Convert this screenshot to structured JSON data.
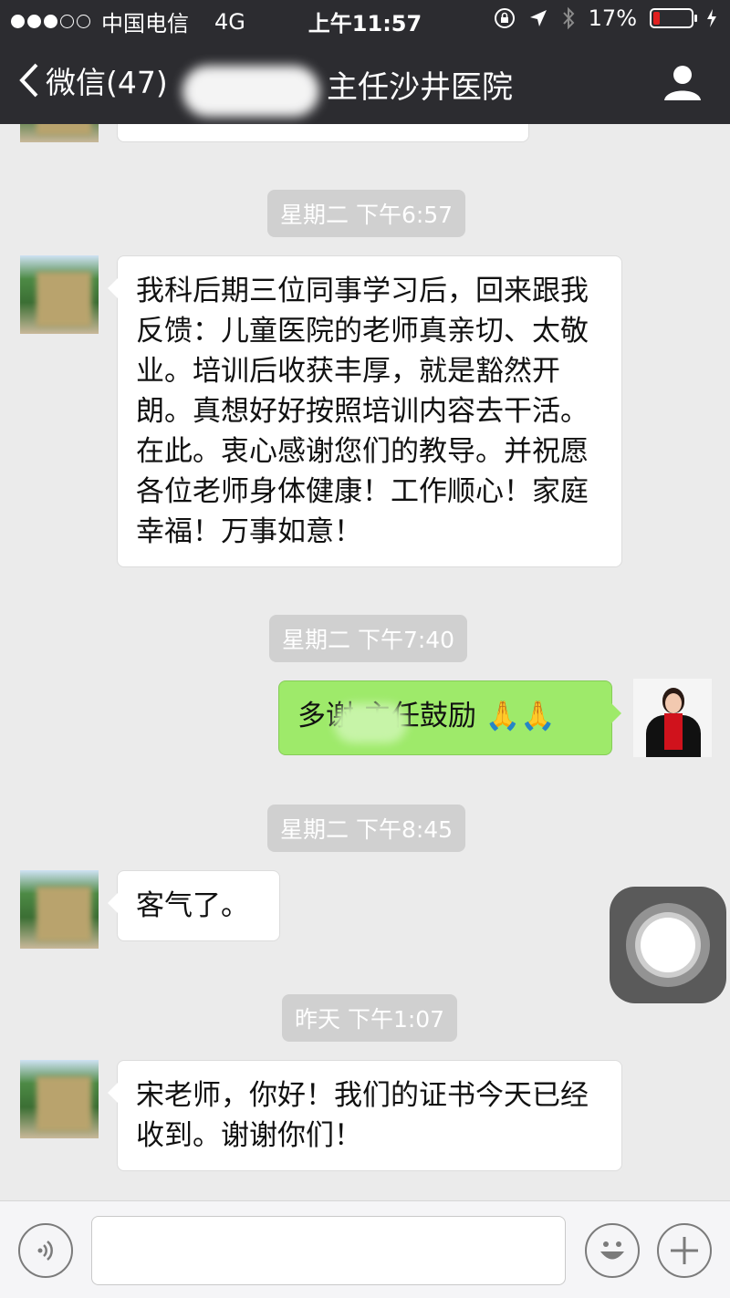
{
  "status_bar": {
    "carrier": "中国电信",
    "network": "4G",
    "time": "上午11:57",
    "battery_text": "17%",
    "battery_level": 0.17,
    "signal_bars_filled": 3,
    "signal_bars_total": 5
  },
  "nav": {
    "back_label": "微信(47)",
    "title": "主任沙井医院"
  },
  "messages": [
    {
      "type": "time",
      "text": "星期二 下午6:57"
    },
    {
      "type": "incoming",
      "text": "我科后期三位同事学习后，回来跟我反馈：儿童医院的老师真亲切、太敬业。培训后收获丰厚，就是豁然开朗。真想好好按照培训内容去干活。在此。衷心感谢您们的教导。并祝愿各位老师身体健康！工作顺心！家庭幸福！万事如意！"
    },
    {
      "type": "time",
      "text": "星期二 下午7:40"
    },
    {
      "type": "outgoing",
      "text_prefix": "多谢",
      "text_suffix": "主任鼓励",
      "emoji": "🙏🙏"
    },
    {
      "type": "time",
      "text": "星期二 下午8:45"
    },
    {
      "type": "incoming",
      "text": "客气了。"
    },
    {
      "type": "time",
      "text": "昨天 下午1:07"
    },
    {
      "type": "incoming",
      "text": "宋老师，你好！我们的证书今天已经收到。谢谢你们！"
    }
  ],
  "input": {
    "value": "",
    "placeholder": ""
  },
  "colors": {
    "nav_bg": "#2c2c30",
    "chat_bg": "#ebebeb",
    "incoming_bubble": "#ffffff",
    "outgoing_bubble": "#9eea6a",
    "battery_low": "#e02020"
  },
  "icons": {
    "back": "chevron-left-icon",
    "profile": "person-icon",
    "voice": "voice-icon",
    "emoji": "emoji-icon",
    "add": "plus-icon"
  }
}
